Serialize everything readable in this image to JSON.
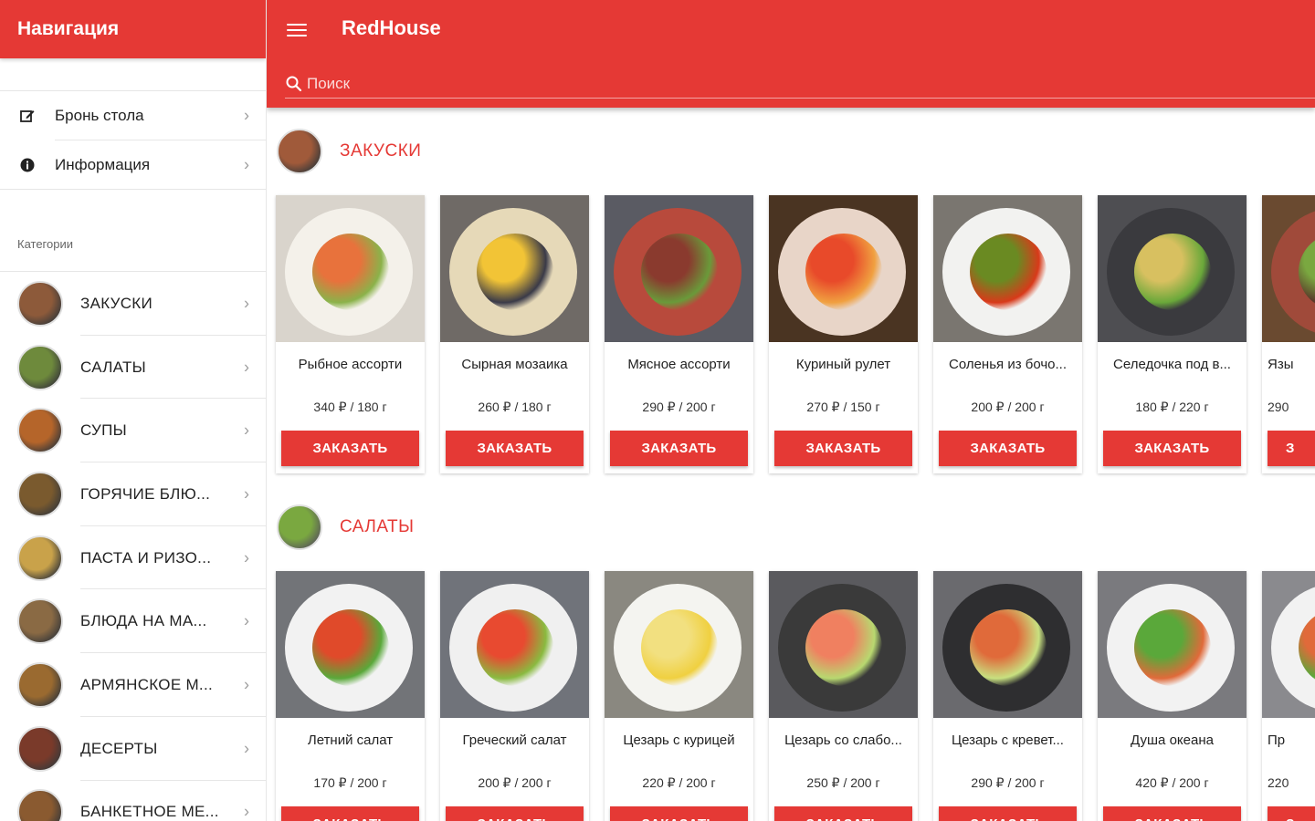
{
  "drawer": {
    "title": "Навигация",
    "nav_items": [
      {
        "label": "Бронь стола",
        "icon": "edit-icon"
      },
      {
        "label": "Информация",
        "icon": "info-icon"
      }
    ],
    "categories_label": "Категории",
    "categories": [
      {
        "label": "ЗАКУСКИ",
        "color": "#8d5a3a"
      },
      {
        "label": "САЛАТЫ",
        "color": "#6e8a3c"
      },
      {
        "label": "СУПЫ",
        "color": "#b5652a"
      },
      {
        "label": "ГОРЯЧИЕ БЛЮ...",
        "color": "#7a5a2e"
      },
      {
        "label": "ПАСТА И РИЗО...",
        "color": "#c9a24a"
      },
      {
        "label": "БЛЮДА НА МА...",
        "color": "#8a6a44"
      },
      {
        "label": "АРМЯНСКОЕ М...",
        "color": "#9a6a30"
      },
      {
        "label": "ДЕСЕРТЫ",
        "color": "#7a3a2a"
      },
      {
        "label": "БАНКЕТНОЕ МЕ...",
        "color": "#8a5a30"
      }
    ]
  },
  "appbar": {
    "title": "RedHouse",
    "search_placeholder": "Поиск"
  },
  "colors": {
    "accent": "#e53935"
  },
  "sections": [
    {
      "title": "ЗАКУСКИ",
      "dishes": [
        {
          "name": "Рыбное ассорти",
          "price": "340 ₽ / 180 г"
        },
        {
          "name": "Сырная мозаика",
          "price": "260 ₽ / 180 г"
        },
        {
          "name": "Мясное ассорти",
          "price": "290 ₽ / 200 г"
        },
        {
          "name": "Куриный рулет",
          "price": "270 ₽ / 150 г"
        },
        {
          "name": "Соленья из бочо...",
          "price": "200 ₽ / 200 г"
        },
        {
          "name": "Селедочка под в...",
          "price": "180 ₽ / 220 г"
        },
        {
          "name": "Язы",
          "price": "290"
        }
      ]
    },
    {
      "title": "САЛАТЫ",
      "dishes": [
        {
          "name": "Летний салат",
          "price": "170 ₽ / 200 г"
        },
        {
          "name": "Греческий салат",
          "price": "200 ₽ / 200 г"
        },
        {
          "name": "Цезарь с курицей",
          "price": "220 ₽ / 200 г"
        },
        {
          "name": "Цезарь со слабо...",
          "price": "250 ₽ / 200 г"
        },
        {
          "name": "Цезарь с кревет...",
          "price": "290 ₽ / 200 г"
        },
        {
          "name": "Душа океана",
          "price": "420 ₽ / 200 г"
        },
        {
          "name": "Пр",
          "price": "220"
        }
      ]
    }
  ],
  "order_label": "ЗАКАЗАТЬ",
  "order_label_partial": "З"
}
